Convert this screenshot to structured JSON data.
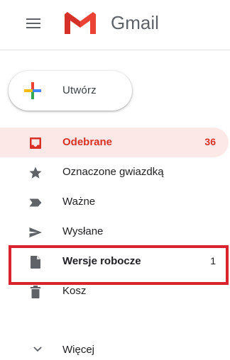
{
  "header": {
    "app_name": "Gmail",
    "brand_color": "#d93025"
  },
  "compose": {
    "label": "Utwórz"
  },
  "nav": {
    "items": [
      {
        "label": "Odebrane",
        "count": "36",
        "icon": "inbox-icon",
        "active": true
      },
      {
        "label": "Oznaczone gwiazdką",
        "count": "",
        "icon": "star-icon"
      },
      {
        "label": "Ważne",
        "count": "",
        "icon": "important-icon"
      },
      {
        "label": "Wysłane",
        "count": "",
        "icon": "send-icon"
      },
      {
        "label": "Wersje robocze",
        "count": "1",
        "icon": "draft-icon",
        "highlighted": true
      },
      {
        "label": "Kosz",
        "count": "",
        "icon": "trash-icon"
      }
    ],
    "more_label": "Więcej"
  },
  "colors": {
    "active_bg": "#fce8e6",
    "active_text": "#d93025",
    "highlight_border": "#d9232e",
    "icon": "#5f6368"
  }
}
